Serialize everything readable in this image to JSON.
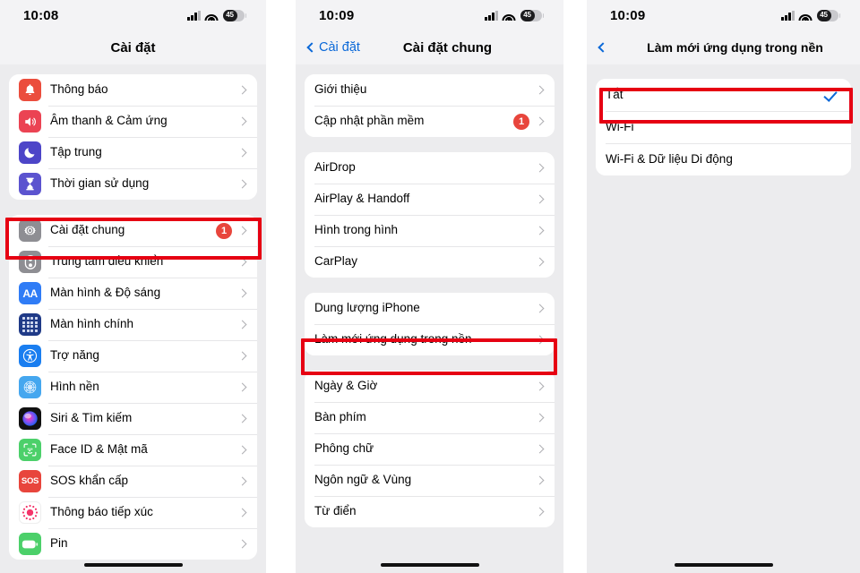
{
  "panels": [
    {
      "id": "settings-root",
      "status": {
        "time": "10:08",
        "battery": "45"
      },
      "nav": {
        "title": "Cài đặt",
        "back_label": ""
      },
      "groups": [
        {
          "items": [
            {
              "label": "Thông báo",
              "icon": "bell-icon",
              "chevron": true
            },
            {
              "label": "Âm thanh & Cảm ứng",
              "icon": "speaker-icon",
              "chevron": true
            },
            {
              "label": "Tập trung",
              "icon": "moon-icon",
              "chevron": true
            },
            {
              "label": "Thời gian sử dụng",
              "icon": "hourglass-icon",
              "chevron": true
            }
          ]
        },
        {
          "items": [
            {
              "label": "Cài đặt chung",
              "icon": "gear-icon",
              "badge": "1",
              "chevron": true,
              "highlight": true
            },
            {
              "label": "Trung tâm điều khiển",
              "icon": "control-center-icon",
              "chevron": true
            },
            {
              "label": "Màn hình & Độ sáng",
              "icon": "display-aa-icon",
              "chevron": true
            },
            {
              "label": "Màn hình chính",
              "icon": "home-screen-icon",
              "chevron": true
            },
            {
              "label": "Trợ năng",
              "icon": "accessibility-icon",
              "chevron": true
            },
            {
              "label": "Hình nền",
              "icon": "wallpaper-icon",
              "chevron": true
            },
            {
              "label": "Siri & Tìm kiếm",
              "icon": "siri-icon",
              "chevron": true
            },
            {
              "label": "Face ID & Mật mã",
              "icon": "face-id-icon",
              "chevron": true
            },
            {
              "label": "SOS khẩn cấp",
              "icon": "sos-icon",
              "chevron": true
            },
            {
              "label": "Thông báo tiếp xúc",
              "icon": "exposure-notification-icon",
              "chevron": true
            },
            {
              "label": "Pin",
              "icon": "battery-icon",
              "chevron": true
            }
          ]
        }
      ]
    },
    {
      "id": "general-settings",
      "status": {
        "time": "10:09",
        "battery": "45"
      },
      "nav": {
        "title": "Cài đặt chung",
        "back_label": "Cài đặt"
      },
      "groups": [
        {
          "items": [
            {
              "label": "Giới thiệu",
              "chevron": true
            },
            {
              "label": "Cập nhật phần mềm",
              "badge": "1",
              "chevron": true
            }
          ]
        },
        {
          "items": [
            {
              "label": "AirDrop",
              "chevron": true
            },
            {
              "label": "AirPlay & Handoff",
              "chevron": true
            },
            {
              "label": "Hình trong hình",
              "chevron": true
            },
            {
              "label": "CarPlay",
              "chevron": true
            }
          ]
        },
        {
          "items": [
            {
              "label": "Dung lượng iPhone",
              "chevron": true
            },
            {
              "label": "Làm mới ứng dụng trong nền",
              "chevron": true,
              "highlight": true
            }
          ]
        },
        {
          "items": [
            {
              "label": "Ngày & Giờ",
              "chevron": true
            },
            {
              "label": "Bàn phím",
              "chevron": true
            },
            {
              "label": "Phông chữ",
              "chevron": true
            },
            {
              "label": "Ngôn ngữ & Vùng",
              "chevron": true
            },
            {
              "label": "Từ điển",
              "chevron": true
            }
          ]
        }
      ]
    },
    {
      "id": "background-app-refresh",
      "status": {
        "time": "10:09",
        "battery": "45"
      },
      "nav": {
        "title": "Làm mới ứng dụng trong nền",
        "back_label": ""
      },
      "groups": [
        {
          "items": [
            {
              "label": "Tắt",
              "check": true,
              "highlight": true
            },
            {
              "label": "Wi-Fi"
            },
            {
              "label": "Wi-Fi & Dữ liệu Di động"
            }
          ]
        }
      ]
    }
  ],
  "colors": {
    "accent_blue": "#0a68d8",
    "badge_red": "#e8453c",
    "highlight_red": "#e60012",
    "panel_bg": "#ececee",
    "card_bg": "#ffffff"
  }
}
